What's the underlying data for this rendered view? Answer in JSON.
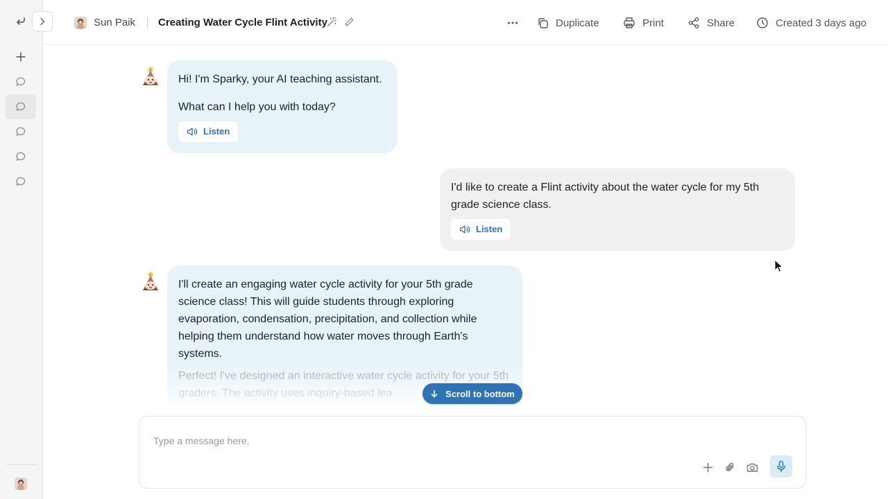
{
  "sidebar": {
    "icons": [
      "back-arrow-icon",
      "plus-icon",
      "chat-icon",
      "chat-icon",
      "chat-icon",
      "chat-icon",
      "chat-icon"
    ],
    "active_index": 1
  },
  "header": {
    "user_name": "Sun Paik",
    "title": "Creating Water Cycle Flint Activity",
    "actions": {
      "more_icon": "more-icon",
      "duplicate": "Duplicate",
      "print": "Print",
      "share": "Share",
      "created": "Created 3 days ago"
    }
  },
  "chat": {
    "messages": [
      {
        "role": "assistant",
        "paragraphs": [
          "Hi! I'm Sparky, your AI teaching assistant.",
          "What can I help you with today?"
        ],
        "listen_label": "Listen"
      },
      {
        "role": "user",
        "paragraphs": [
          "I'd like to create a Flint activity about the water cycle for my 5th grade science class."
        ],
        "listen_label": "Listen"
      },
      {
        "role": "assistant",
        "paragraphs": [
          "I'll create an engaging water cycle activity for your 5th grade science class! This will guide students through exploring evaporation, condensation, precipitation, and collection while helping them understand how water moves through Earth's systems.",
          "Perfect! I've designed an interactive water cycle activity for your 5th graders. The activity uses inquiry-based lea"
        ]
      }
    ],
    "scroll_to_bottom": "Scroll to bottom"
  },
  "composer": {
    "placeholder": "Type a message here.",
    "icons": [
      "plus-icon",
      "paperclip-icon",
      "camera-icon",
      "microphone-icon"
    ]
  },
  "colors": {
    "accent": "#2f73b5",
    "bot_bubble": "#e6f3f9",
    "user_bubble": "#f0f0f0",
    "sidebar_bg": "#f5f5f5"
  }
}
